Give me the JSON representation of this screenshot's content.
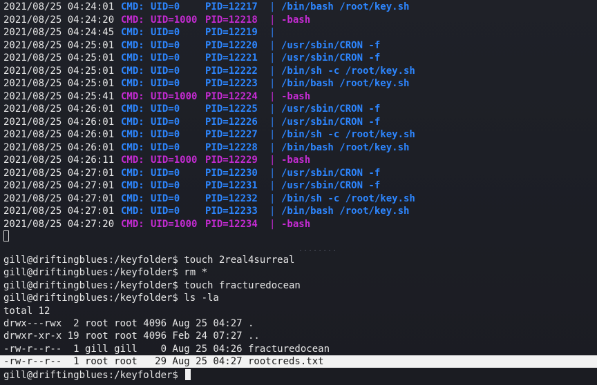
{
  "window": {
    "app": "terminal"
  },
  "pspy_log": [
    {
      "ts": "2021/08/25 04:24:01",
      "label": "CMD:",
      "uid": "UID=0",
      "pid": "PID=12217",
      "cmd": "/bin/bash /root/key.sh",
      "kind": "root"
    },
    {
      "ts": "2021/08/25 04:24:20",
      "label": "CMD:",
      "uid": "UID=1000",
      "pid": "PID=12218",
      "cmd": "-bash",
      "kind": "user"
    },
    {
      "ts": "2021/08/25 04:24:45",
      "label": "CMD:",
      "uid": "UID=0",
      "pid": "PID=12219",
      "cmd": "",
      "kind": "root"
    },
    {
      "ts": "2021/08/25 04:25:01",
      "label": "CMD:",
      "uid": "UID=0",
      "pid": "PID=12220",
      "cmd": "/usr/sbin/CRON -f",
      "kind": "root"
    },
    {
      "ts": "2021/08/25 04:25:01",
      "label": "CMD:",
      "uid": "UID=0",
      "pid": "PID=12221",
      "cmd": "/usr/sbin/CRON -f",
      "kind": "root"
    },
    {
      "ts": "2021/08/25 04:25:01",
      "label": "CMD:",
      "uid": "UID=0",
      "pid": "PID=12222",
      "cmd": "/bin/sh -c /root/key.sh",
      "kind": "root"
    },
    {
      "ts": "2021/08/25 04:25:01",
      "label": "CMD:",
      "uid": "UID=0",
      "pid": "PID=12223",
      "cmd": "/bin/bash /root/key.sh",
      "kind": "root"
    },
    {
      "ts": "2021/08/25 04:25:41",
      "label": "CMD:",
      "uid": "UID=1000",
      "pid": "PID=12224",
      "cmd": "-bash",
      "kind": "user"
    },
    {
      "ts": "2021/08/25 04:26:01",
      "label": "CMD:",
      "uid": "UID=0",
      "pid": "PID=12225",
      "cmd": "/usr/sbin/CRON -f",
      "kind": "root"
    },
    {
      "ts": "2021/08/25 04:26:01",
      "label": "CMD:",
      "uid": "UID=0",
      "pid": "PID=12226",
      "cmd": "/usr/sbin/CRON -f",
      "kind": "root"
    },
    {
      "ts": "2021/08/25 04:26:01",
      "label": "CMD:",
      "uid": "UID=0",
      "pid": "PID=12227",
      "cmd": "/bin/sh -c /root/key.sh",
      "kind": "root"
    },
    {
      "ts": "2021/08/25 04:26:01",
      "label": "CMD:",
      "uid": "UID=0",
      "pid": "PID=12228",
      "cmd": "/bin/bash /root/key.sh",
      "kind": "root"
    },
    {
      "ts": "2021/08/25 04:26:11",
      "label": "CMD:",
      "uid": "UID=1000",
      "pid": "PID=12229",
      "cmd": "-bash",
      "kind": "user"
    },
    {
      "ts": "2021/08/25 04:27:01",
      "label": "CMD:",
      "uid": "UID=0",
      "pid": "PID=12230",
      "cmd": "/usr/sbin/CRON -f",
      "kind": "root"
    },
    {
      "ts": "2021/08/25 04:27:01",
      "label": "CMD:",
      "uid": "UID=0",
      "pid": "PID=12231",
      "cmd": "/usr/sbin/CRON -f",
      "kind": "root"
    },
    {
      "ts": "2021/08/25 04:27:01",
      "label": "CMD:",
      "uid": "UID=0",
      "pid": "PID=12232",
      "cmd": "/bin/sh -c /root/key.sh",
      "kind": "root"
    },
    {
      "ts": "2021/08/25 04:27:01",
      "label": "CMD:",
      "uid": "UID=0",
      "pid": "PID=12233",
      "cmd": "/bin/bash /root/key.sh",
      "kind": "root"
    },
    {
      "ts": "2021/08/25 04:27:20",
      "label": "CMD:",
      "uid": "UID=1000",
      "pid": "PID=12234",
      "cmd": "-bash",
      "kind": "user"
    }
  ],
  "shell": {
    "lines": [
      "gill@driftingblues:/keyfolder$ touch 2real4surreal",
      "gill@driftingblues:/keyfolder$ rm *",
      "gill@driftingblues:/keyfolder$ touch fracturedocean",
      "gill@driftingblues:/keyfolder$ ls -la",
      "total 12",
      "drwx---rwx  2 root root 4096 Aug 25 04:27 .",
      "drwxr-xr-x 19 root root 4096 Feb 24 07:27 ..",
      "-rw-r--r--  1 gill gill    0 Aug 25 04:26 fracturedocean"
    ],
    "highlighted_line": "-rw-r--r--  1 root root   29 Aug 25 04:27 rootcreds.txt",
    "prompt": "gill@driftingblues:/keyfolder$ "
  },
  "colors": {
    "root_process": "#2d86ff",
    "user_process": "#c42bd2",
    "background": "#1c1e25",
    "foreground": "#e6e6e6",
    "highlight_bg": "#f2f2f2"
  }
}
